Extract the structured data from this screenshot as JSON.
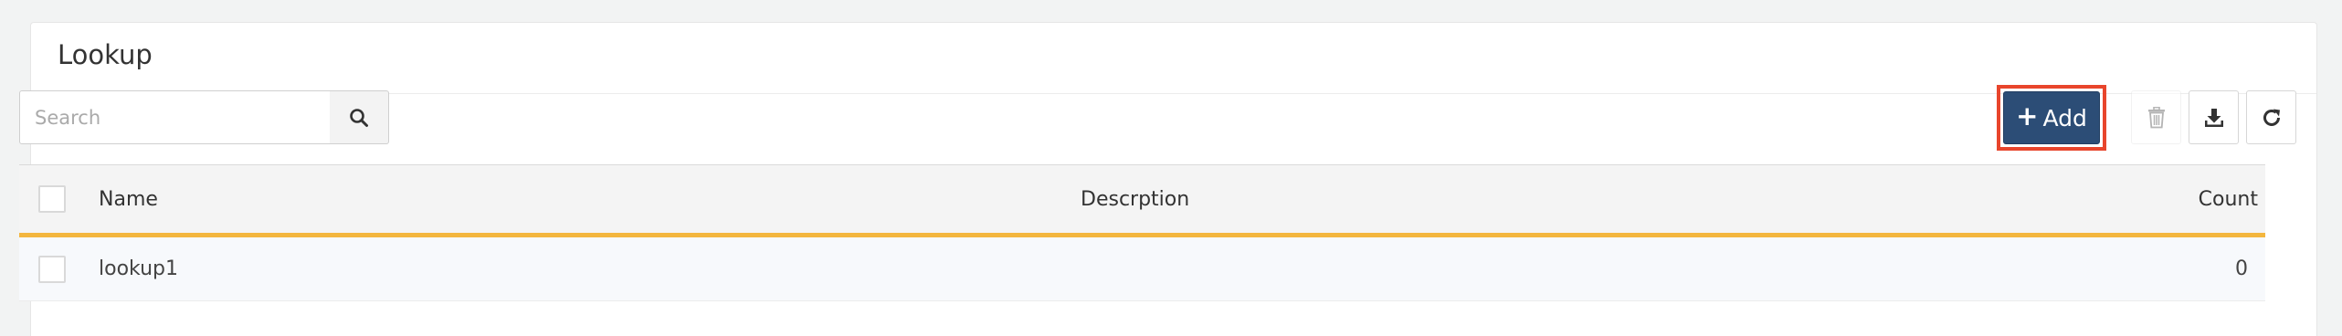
{
  "panel": {
    "title": "Lookup"
  },
  "toolbar": {
    "search_placeholder": "Search",
    "add_label": "Add",
    "icons": {
      "search": "search-icon",
      "add": "plus-icon",
      "delete": "trash-icon",
      "download": "download-icon",
      "refresh": "refresh-icon"
    }
  },
  "table": {
    "columns": [
      "Name",
      "Descrption",
      "Count"
    ],
    "rows": [
      {
        "name": "lookup1",
        "description": "",
        "count": "0"
      }
    ]
  },
  "colors": {
    "primary_button": "#2c4d76",
    "highlight_outline": "#e8452c",
    "header_underline": "#f3b63e"
  }
}
